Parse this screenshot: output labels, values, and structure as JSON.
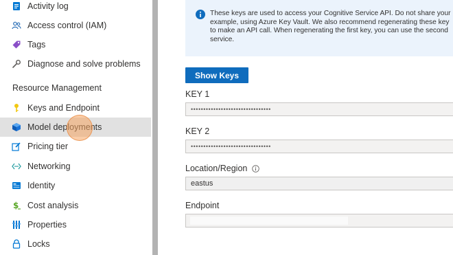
{
  "sidebar": {
    "items_top": [
      {
        "label": "Activity log",
        "icon": "activity-log-icon"
      },
      {
        "label": "Access control (IAM)",
        "icon": "people-icon"
      },
      {
        "label": "Tags",
        "icon": "tag-icon"
      },
      {
        "label": "Diagnose and solve problems",
        "icon": "wrench-icon"
      }
    ],
    "section_header": "Resource Management",
    "items_resource": [
      {
        "label": "Keys and Endpoint",
        "icon": "key-icon"
      },
      {
        "label": "Model deployments",
        "icon": "cube-icon",
        "selected": true
      },
      {
        "label": "Pricing tier",
        "icon": "edit-icon"
      },
      {
        "label": "Networking",
        "icon": "network-icon"
      },
      {
        "label": "Identity",
        "icon": "identity-icon"
      },
      {
        "label": "Cost analysis",
        "icon": "dollar-icon"
      },
      {
        "label": "Properties",
        "icon": "properties-icon"
      },
      {
        "label": "Locks",
        "icon": "lock-icon"
      }
    ]
  },
  "main": {
    "info_lines": [
      "These keys are used to access your Cognitive Service API. Do not share your",
      "example, using Azure Key Vault. We also recommend regenerating these key",
      "to make an API call. When regenerating the first key, you can use the second",
      "service."
    ],
    "show_keys_label": "Show Keys",
    "key1_label": "KEY 1",
    "key1_value": "••••••••••••••••••••••••••••••••",
    "key2_label": "KEY 2",
    "key2_value": "••••••••••••••••••••••••••••••••",
    "location_label": "Location/Region",
    "location_value": "eastus",
    "endpoint_label": "Endpoint"
  },
  "colors": {
    "accent": "#0f6cbd",
    "info_bg": "#ebf3fc",
    "selected_bg": "#e1e1e1"
  }
}
